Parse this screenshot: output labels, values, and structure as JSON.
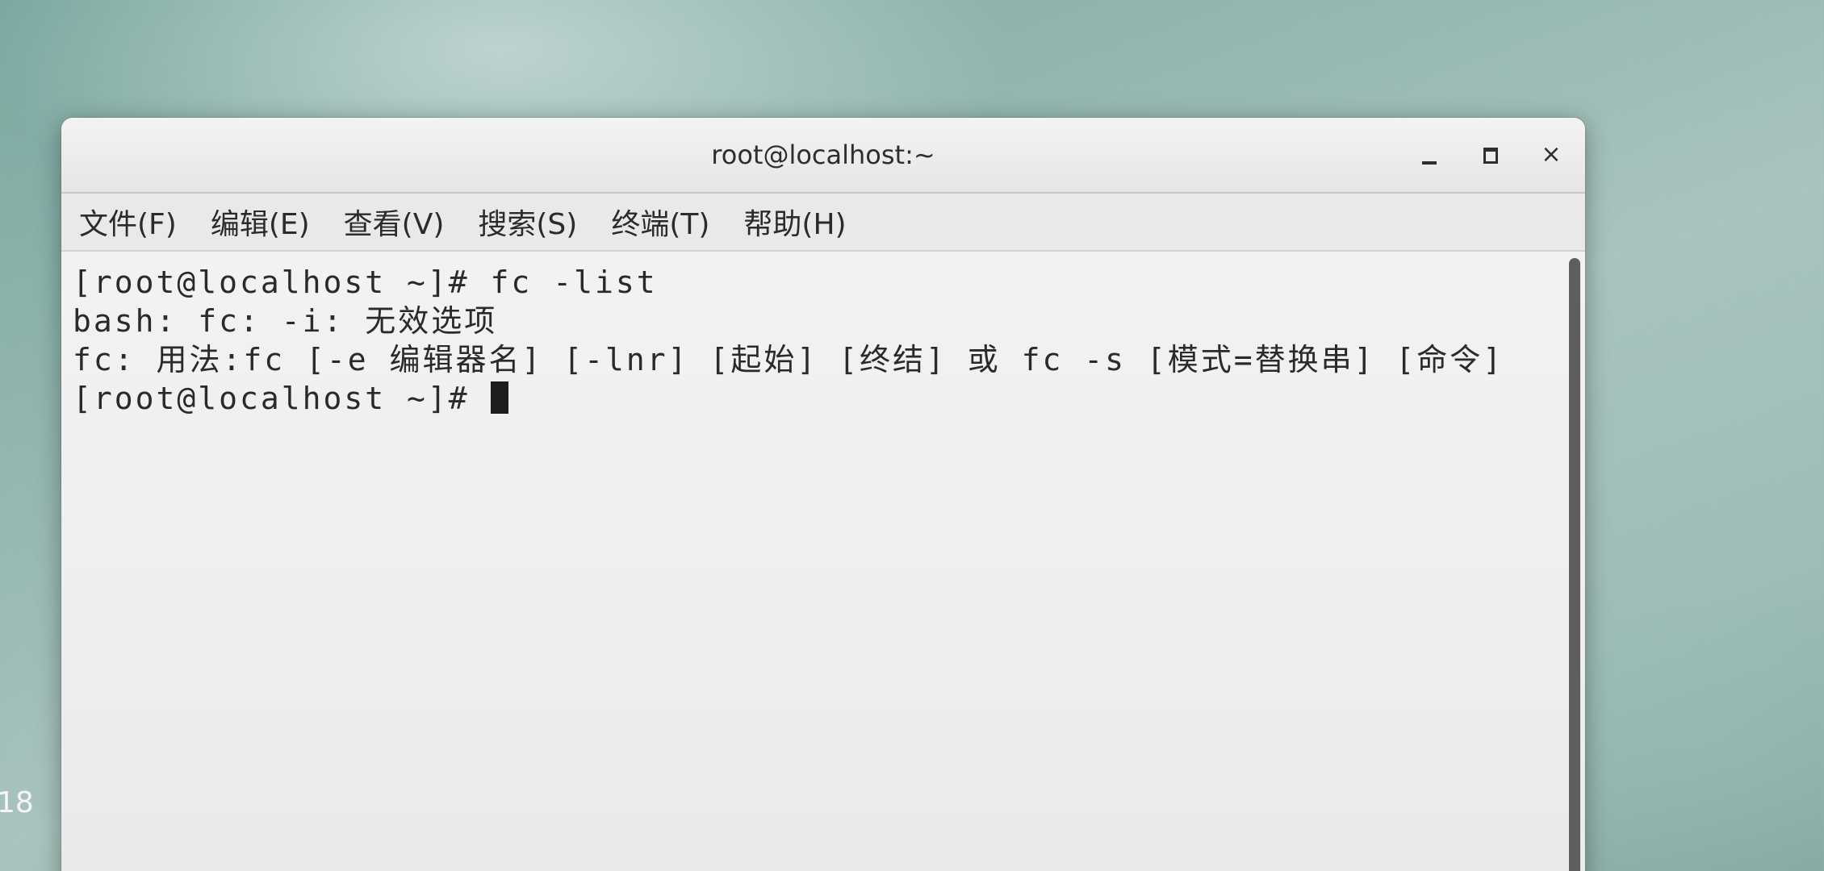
{
  "desktop": {
    "label": "18"
  },
  "window": {
    "title": "root@localhost:~",
    "controls": {
      "minimize_icon": "minimize-icon",
      "maximize_icon": "maximize-icon",
      "close_glyph": "×"
    }
  },
  "menubar": {
    "items": [
      {
        "label": "文件(F)"
      },
      {
        "label": "编辑(E)"
      },
      {
        "label": "查看(V)"
      },
      {
        "label": "搜索(S)"
      },
      {
        "label": "终端(T)"
      },
      {
        "label": "帮助(H)"
      }
    ]
  },
  "terminal": {
    "lines": [
      "[root@localhost ~]# fc -list",
      "bash: fc: -i: 无效选项",
      "fc: 用法:fc [-e 编辑器名] [-lnr] [起始] [终结] 或 fc -s [模式=替换串] [命令]"
    ],
    "prompt": "[root@localhost ~]# "
  },
  "colors": {
    "window_bg": "#f0f0ef",
    "terminal_text": "#2a2a2a",
    "desktop_bg": "#8fb4ad"
  }
}
